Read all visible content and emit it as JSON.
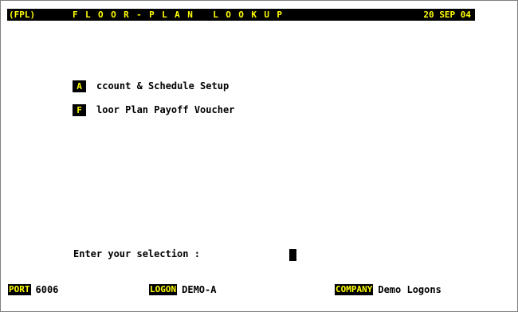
{
  "header": {
    "code": "(FPL)",
    "title": "FLOOR-PLAN LOOKUP",
    "date": "20 SEP 04"
  },
  "menu": [
    {
      "key": "A",
      "label": "ccount & Schedule Setup"
    },
    {
      "key": "F",
      "label": "loor Plan Payoff Voucher"
    }
  ],
  "prompt": {
    "label": "Enter your selection :",
    "value": ""
  },
  "status": {
    "port_label": "PORT",
    "port_value": "6006",
    "logon_label": "LOGON",
    "logon_value": "DEMO-A",
    "company_label": "COMPANY",
    "company_value": "Demo Logons"
  },
  "colors": {
    "background": "#ffffff",
    "highlight_bg": "#000000",
    "highlight_fg": "#ffff00",
    "text": "#000000"
  }
}
